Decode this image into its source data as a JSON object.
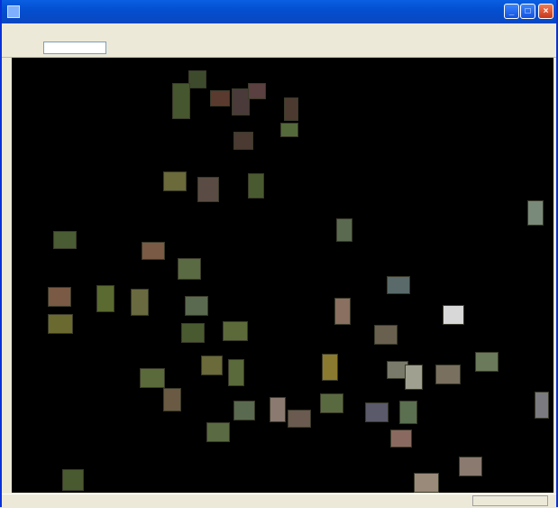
{
  "window": {
    "title": "",
    "controls": {
      "minimize_glyph": "_",
      "maximize_glyph": "□",
      "close_glyph": "×"
    },
    "title_bar_color": "#0a54d8",
    "close_button_color": "#d8482a"
  },
  "menubar": {
    "items": [
      {
        "label": ""
      },
      {
        "label": ""
      },
      {
        "label": ""
      },
      {
        "label": ""
      },
      {
        "label": ""
      }
    ]
  },
  "toolbar": {
    "label": "",
    "field_value": ""
  },
  "canvas": {
    "background": "#000000",
    "caption": ""
  },
  "statusbar": {
    "text": "",
    "panel_text": ""
  }
}
